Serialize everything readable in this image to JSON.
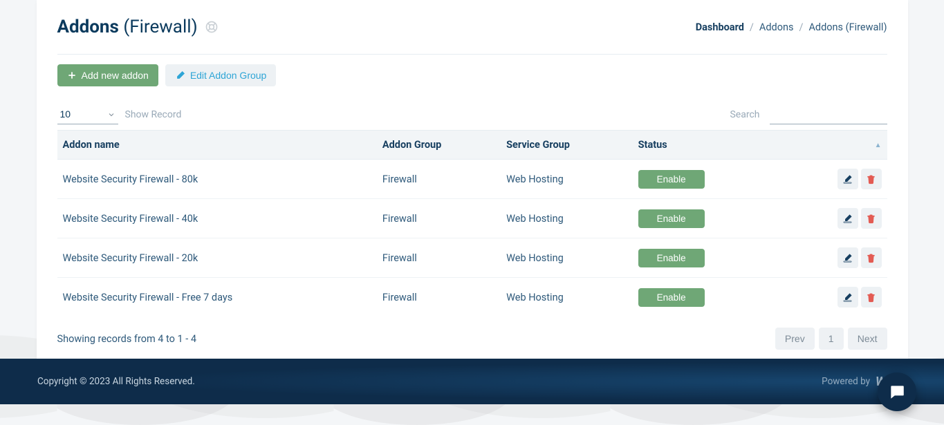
{
  "page": {
    "title_strong": "Addons",
    "title_thin": "(Firewall)"
  },
  "breadcrumb": {
    "dashboard": "Dashboard",
    "addons": "Addons",
    "current": "Addons (Firewall)",
    "sep": "/"
  },
  "actions": {
    "add_new": "Add new addon",
    "edit_group": "Edit Addon Group"
  },
  "controls": {
    "per_page": "10",
    "show_record_label": "Show Record",
    "search_label": "Search",
    "search_value": ""
  },
  "columns": {
    "addon_name": "Addon name",
    "addon_group": "Addon Group",
    "service_group": "Service Group",
    "status": "Status"
  },
  "rows": [
    {
      "name": "Website Security Firewall - 80k",
      "group": "Firewall",
      "service": "Web Hosting",
      "status": "Enable"
    },
    {
      "name": "Website Security Firewall - 40k",
      "group": "Firewall",
      "service": "Web Hosting",
      "status": "Enable"
    },
    {
      "name": "Website Security Firewall - 20k",
      "group": "Firewall",
      "service": "Web Hosting",
      "status": "Enable"
    },
    {
      "name": "Website Security Firewall - Free 7 days",
      "group": "Firewall",
      "service": "Web Hosting",
      "status": "Enable"
    }
  ],
  "footer_table": {
    "records_info": "Showing records from 4 to 1 - 4",
    "prev": "Prev",
    "page_num": "1",
    "next": "Next"
  },
  "site_footer": {
    "copyright": "Copyright © 2023 All Rights Reserved.",
    "powered_label": "Powered by",
    "powered_logo": "WISE"
  },
  "colors": {
    "primary_dark": "#0e2c4a",
    "text_navy": "#173f60",
    "green": "#6fa776",
    "cyan": "#2ea5d6",
    "danger": "#e35b53",
    "muted": "#9aaab8"
  }
}
